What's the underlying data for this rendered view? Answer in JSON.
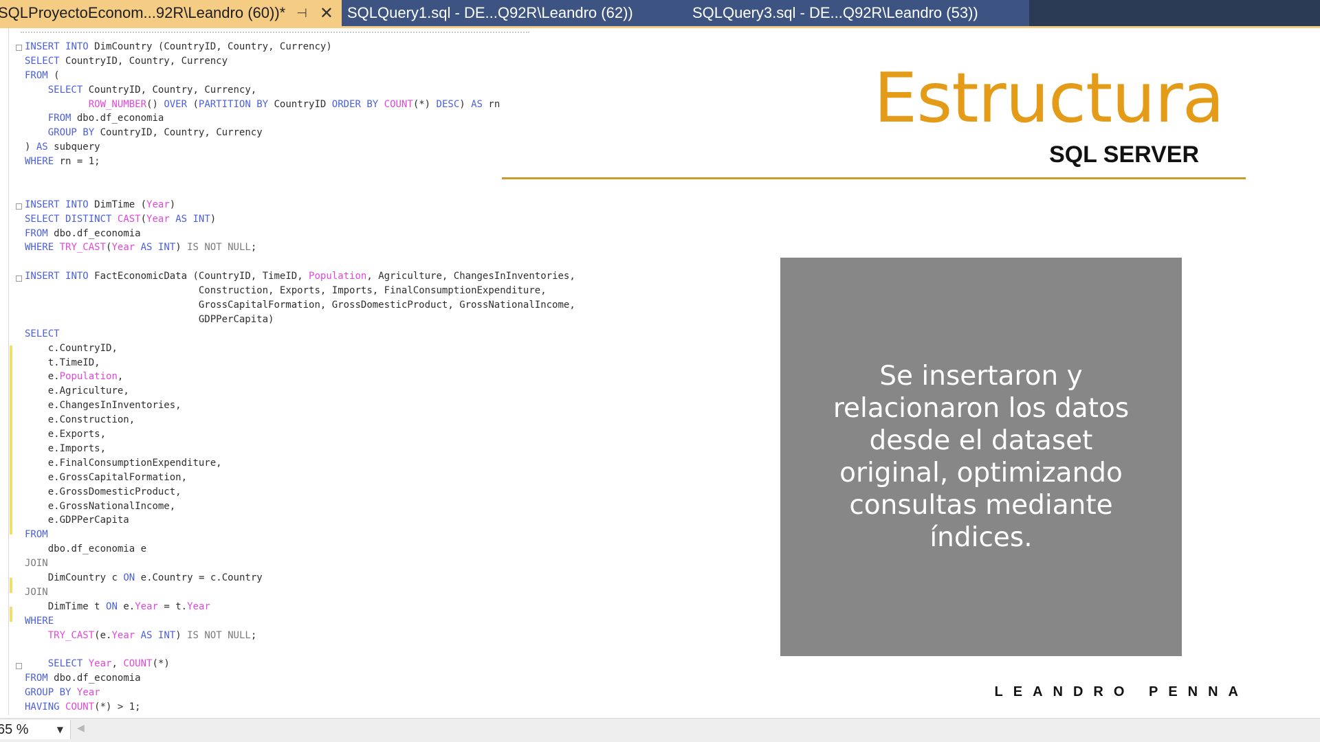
{
  "tabs": [
    {
      "label": "SQLProyectoEconom...92R\\Leandro (60))*",
      "active": true,
      "pin_icon": "pin-icon",
      "close_icon": "close-icon"
    },
    {
      "label": "SQLQuery1.sql - DE...Q92R\\Leandro (62))",
      "active": false
    },
    {
      "label": "SQLQuery3.sql - DE...Q92R\\Leandro (53))",
      "active": false
    }
  ],
  "colors": {
    "keyword": "#4a5fe0",
    "function": "#e048d8",
    "accent": "#e39b18",
    "rule": "#c99a2e",
    "box": "#878787",
    "active_tab": "#f5cc84"
  },
  "code_lines": [
    "INSERT INTO DimCountry (CountryID, Country, Currency)",
    "SELECT CountryID, Country, Currency",
    "FROM (",
    "    SELECT CountryID, Country, Currency,",
    "           ROW_NUMBER() OVER (PARTITION BY CountryID ORDER BY COUNT(*) DESC) AS rn",
    "    FROM dbo.df_economia",
    "    GROUP BY CountryID, Country, Currency",
    ") AS subquery",
    "WHERE rn = 1;",
    "",
    "",
    "INSERT INTO DimTime (Year)",
    "SELECT DISTINCT CAST(Year AS INT)",
    "FROM dbo.df_economia",
    "WHERE TRY_CAST(Year AS INT) IS NOT NULL;",
    "",
    "INSERT INTO FactEconomicData (CountryID, TimeID, Population, Agriculture, ChangesInInventories,",
    "                              Construction, Exports, Imports, FinalConsumptionExpenditure,",
    "                              GrossCapitalFormation, GrossDomesticProduct, GrossNationalIncome,",
    "                              GDPPerCapita)",
    "SELECT",
    "    c.CountryID,",
    "    t.TimeID,",
    "    e.Population,",
    "    e.Agriculture,",
    "    e.ChangesInInventories,",
    "    e.Construction,",
    "    e.Exports,",
    "    e.Imports,",
    "    e.FinalConsumptionExpenditure,",
    "    e.GrossCapitalFormation,",
    "    e.GrossDomesticProduct,",
    "    e.GrossNationalIncome,",
    "    e.GDPPerCapita",
    "FROM",
    "    dbo.df_economia e",
    "JOIN",
    "    DimCountry c ON e.Country = c.Country",
    "JOIN",
    "    DimTime t ON e.Year = t.Year",
    "WHERE",
    "    TRY_CAST(e.Year AS INT) IS NOT NULL;",
    "",
    "    SELECT Year, COUNT(*)",
    "FROM dbo.df_economia",
    "GROUP BY Year",
    "HAVING COUNT(*) > 1;"
  ],
  "slide": {
    "title": "Estructura",
    "subtitle": "SQL SERVER",
    "box_text": "Se insertaron y relacionaron los datos desde el dataset original, optimizando consultas mediante índices.",
    "author": "LEANDRO PENNA"
  },
  "statusbar": {
    "zoom": "65 %",
    "zoom_icon": "chevron-down-icon",
    "scroll_icon": "scroll-left-icon"
  }
}
